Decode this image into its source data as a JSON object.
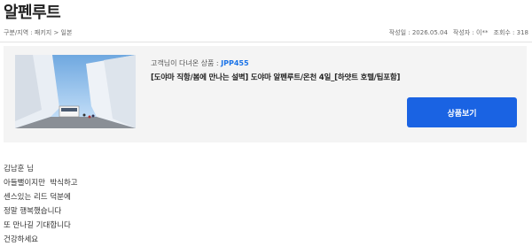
{
  "page": {
    "title": "알펜루트"
  },
  "meta": {
    "breadcrumb": "구분/지역 : 패키지 > 일본",
    "date": "작성일 : 2026.05.04",
    "author": "작성자 : 이**",
    "views": "조회수 : 318"
  },
  "product": {
    "label": "고객님이 다녀온 상품 : ",
    "code": "JPP455",
    "name": "[도야마 직항/봄에 만나는 설벽] 도야마 알펜루트/온천 4일_[하얏트 호텔/팁포함]",
    "button_label": "상품보기",
    "thumbnail_icon": "snow-wall-photo",
    "accent_color": "#1a63e3"
  },
  "review": {
    "lines": [
      "김남훈 님",
      "아들뻘이지만  박식하고",
      "센스있는 리드 덕분에",
      "정말 행복했습니다",
      "또 만나길 기대합니다",
      "건강하세요"
    ]
  }
}
